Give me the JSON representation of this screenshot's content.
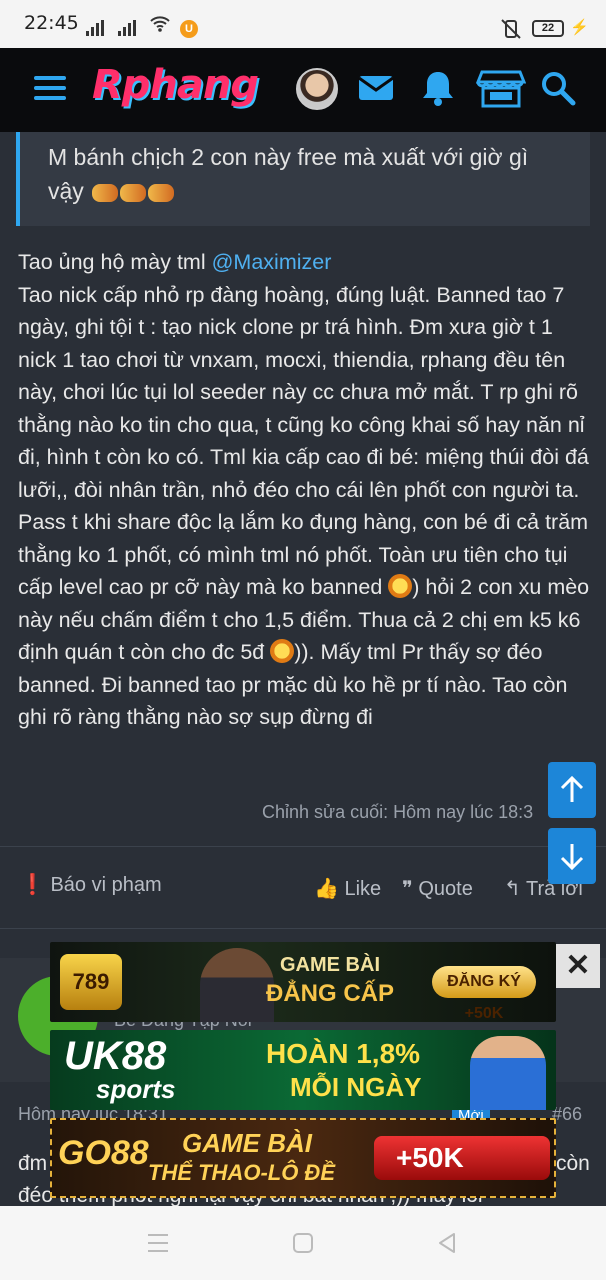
{
  "status_bar": {
    "time": "22:45",
    "battery": "22",
    "badge": "U"
  },
  "header": {
    "logo_text": "Rphang"
  },
  "quote": {
    "text": "M bánh chịch 2 con này free mà xuất với giờ gì vậy"
  },
  "post": {
    "intro": "Tao ủng hộ mày tml ",
    "mention": "@Maximizer",
    "body_1": "Tao nick cấp nhỏ rp đàng hoàng, đúng luật. Banned tao 7 ngày, ghi tội t : tạo nick clone pr trá hình. Đm xưa giờ t 1 nick 1 tao chơi từ vnxam, mocxi, thiendia, rphang đều tên này, chơi lúc tụi lol seeder này cc chưa mở mắt. T rp ghi rõ thằng nào ko tin cho qua, t cũng ko công khai số hay năn nỉ đi, hình t còn ko có. Tml kia cấp cao đi bé: miệng thúi đòi đá lưỡi,, đòi nhân trần, nhỏ đéo cho cái lên phốt con người ta. Pass t khi share độc lạ lắm ko đụng hàng, con bé đi cả trăm thằng ko 1 phốt, có mình tml nó phốt. Toàn ưu tiên cho tụi cấp level cao pr cỡ này mà ko banned ",
    "body_2": ") hỏi 2 con xu mèo này nếu chấm điểm t cho 1,5 điểm. Thua cả 2 chị em k5 k6 định quán t còn cho đc 5đ ",
    "body_3": ")). Mấy tml Pr thấy sợ đéo banned. Đi banned tao pr mặc dù ko hề pr tí nào. Tao còn ghi rõ ràng thằng nào sợ sụp đừng đi",
    "edited": "Chỉnh sửa cuối: Hôm nay lúc 18:3"
  },
  "actions": {
    "report": "Báo vi phạm",
    "like": "Like",
    "quote": "Quote",
    "reply": "Trả lời"
  },
  "next_post": {
    "user_title": "Bé Đang Tập Nói",
    "time": "Hôm nay lúc 18:31",
    "new_badge": "Mới",
    "number": "#66",
    "line1_start": "đm",
    "line1_end": "còn",
    "line2": "đéo thèm phốt nghĩ lại vậy chi bất nhân ;)) máy lol"
  },
  "ads": {
    "ad1": {
      "brand": "789",
      "title1": "GAME BÀI",
      "title2": "ĐẲNG CẤP",
      "cta": "ĐĂNG KÝ +50K"
    },
    "ad2": {
      "brand": "UK88",
      "brand_sub": "sports",
      "title1": "HOÀN 1,8%",
      "title2": "MỖI NGÀY"
    },
    "ad3": {
      "brand": "GO88",
      "title1": "GAME BÀI",
      "title2": "THỂ THAO-LÔ ĐỀ",
      "cta": "+50K"
    },
    "close": "✕"
  },
  "colors": {
    "accent": "#2fa7f0",
    "background": "#2a2f37",
    "link": "#4fb0f0"
  }
}
